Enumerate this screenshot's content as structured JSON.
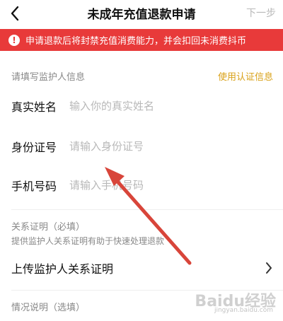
{
  "header": {
    "title": "未成年充值退款申请",
    "next_label": "下一步"
  },
  "warning": {
    "icon": "!",
    "text": "申请退款后将封禁充值消费能力，并会扣回未消费抖币"
  },
  "guardian_section": {
    "label": "请填写监护人信息",
    "link": "使用认证信息"
  },
  "fields": {
    "name": {
      "label": "真实姓名",
      "placeholder": "输入你的真实姓名"
    },
    "id": {
      "label": "身份证号",
      "placeholder": "请输入身份证号"
    },
    "phone": {
      "label": "手机号码",
      "placeholder": "请输入手机号码"
    }
  },
  "relation": {
    "label": "关系证明（必填）",
    "hint": "提供监护人关系证明有助于快速处理退款",
    "upload_label": "上传监护人关系证明"
  },
  "situation": {
    "label": "情况说明（选填）"
  },
  "watermark": {
    "brand": "Baidu经验",
    "url": "jingyan.baidu.com"
  },
  "colors": {
    "warning_bg": "#e83a3a",
    "link": "#d9a118",
    "annotation_arrow": "#d8453a"
  }
}
